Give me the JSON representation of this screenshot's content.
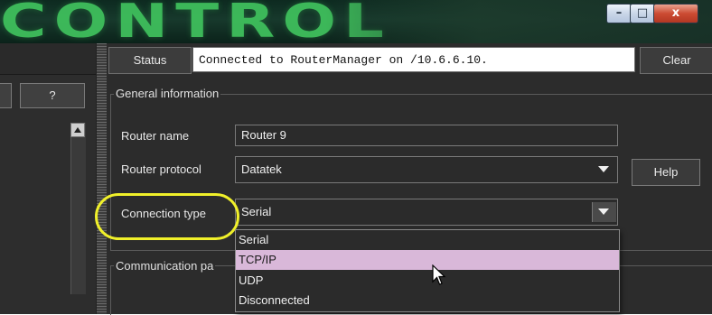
{
  "window": {
    "title_logo": "CONTROL",
    "minimize_label": "–",
    "maximize_label": "□",
    "close_label": "x"
  },
  "left_pane": {
    "help_button_label": "?"
  },
  "status_bar": {
    "status_label": "Status",
    "status_text": "Connected to RouterManager on /10.6.6.10.",
    "clear_label": "Clear"
  },
  "general_info": {
    "title": "General information",
    "router_name_label": "Router name",
    "router_name_value": "Router 9",
    "router_protocol_label": "Router protocol",
    "router_protocol_value": "Datatek",
    "help_label": "Help",
    "connection_type_label": "Connection type",
    "connection_type_value": "Serial"
  },
  "connection_type_options": [
    "Serial",
    "TCP/IP",
    "UDP",
    "Disconnected"
  ],
  "highlighted_option": "TCP/IP",
  "communication": {
    "title_partial": "Communication pa"
  },
  "colors": {
    "accent_highlight": "#d9b8d9",
    "annotation_oval": "#f0f02a",
    "background": "#2c2c2c"
  }
}
